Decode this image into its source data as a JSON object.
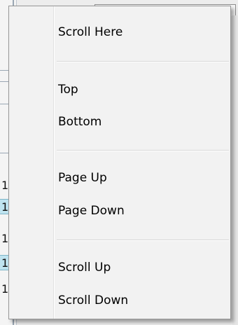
{
  "background": {
    "row_digits": [
      "1",
      "1",
      "1",
      "1",
      "1"
    ]
  },
  "context_menu": {
    "items": [
      {
        "label": "Scroll Here"
      },
      {
        "label": "Top"
      },
      {
        "label": "Bottom"
      },
      {
        "label": "Page Up"
      },
      {
        "label": "Page Down"
      },
      {
        "label": "Scroll Up"
      },
      {
        "label": "Scroll Down"
      }
    ]
  },
  "colors": {
    "menu_background": "#f2f2f2",
    "menu_border": "#979797",
    "row_highlight": "#bfe3ef"
  }
}
